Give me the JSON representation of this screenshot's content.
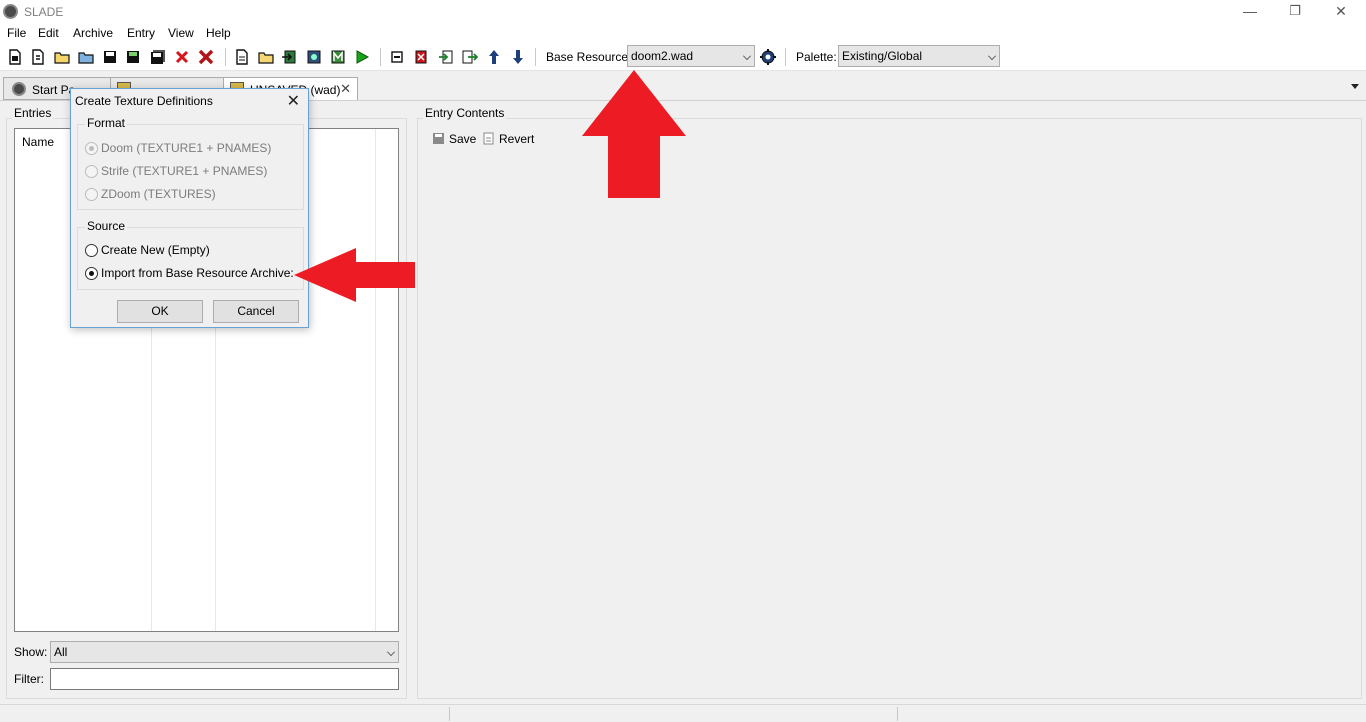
{
  "window": {
    "title": "SLADE",
    "minimize": "—",
    "restore": "❐",
    "close": "✕"
  },
  "menu": [
    "File",
    "Edit",
    "Archive",
    "Entry",
    "View",
    "Help"
  ],
  "toolbar": {
    "base_resource_label": "Base Resource:",
    "base_resource_value": "doom2.wad",
    "palette_label": "Palette:",
    "palette_value": "Existing/Global"
  },
  "tabs": [
    {
      "label": "Start Pa",
      "active": false
    },
    {
      "label": "",
      "active": false
    },
    {
      "label": "UNSAVED (wad)",
      "active": true
    }
  ],
  "entries_panel": {
    "title": "Entries",
    "column_name": "Name",
    "show_label": "Show:",
    "show_value": "All",
    "filter_label": "Filter:",
    "filter_value": ""
  },
  "entry_contents": {
    "title": "Entry Contents",
    "save_label": "Save",
    "revert_label": "Revert"
  },
  "dialog": {
    "title": "Create Texture Definitions",
    "format_label": "Format",
    "format_options": [
      {
        "label": "Doom (TEXTURE1 + PNAMES)",
        "checked": true
      },
      {
        "label": "Strife (TEXTURE1 + PNAMES)",
        "checked": false
      },
      {
        "label": "ZDoom (TEXTURES)",
        "checked": false
      }
    ],
    "source_label": "Source",
    "source_options": [
      {
        "label": "Create New (Empty)",
        "checked": false
      },
      {
        "label": "Import from Base Resource Archive:",
        "checked": true
      }
    ],
    "ok_label": "OK",
    "cancel_label": "Cancel"
  },
  "colors": {
    "annotation_arrow": "#ed1c24",
    "dialog_border": "#6aa0d8"
  }
}
